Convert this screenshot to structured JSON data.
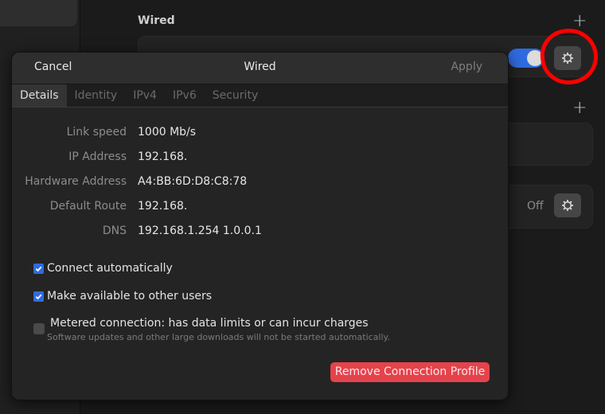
{
  "background": {
    "section_title": "Wired",
    "off_label": "Off"
  },
  "dialog": {
    "header": {
      "cancel_label": "Cancel",
      "title": "Wired",
      "apply_label": "Apply"
    },
    "tabs": [
      {
        "label": "Details",
        "active": true
      },
      {
        "label": "Identity",
        "active": false
      },
      {
        "label": "IPv4",
        "active": false
      },
      {
        "label": "IPv6",
        "active": false
      },
      {
        "label": "Security",
        "active": false
      }
    ],
    "details": [
      {
        "label": "Link speed",
        "value": "1000 Mb/s"
      },
      {
        "label": "IP Address",
        "value": "192.168."
      },
      {
        "label": "Hardware Address",
        "value": "A4:BB:6D:D8:C8:78"
      },
      {
        "label": "Default Route",
        "value": "192.168."
      },
      {
        "label": "DNS",
        "value": "192.168.1.254 1.0.0.1"
      }
    ],
    "options": {
      "connect_automatically": {
        "label": "Connect automatically",
        "checked": true
      },
      "available_to_others": {
        "label": "Make available to other users",
        "checked": true
      },
      "metered": {
        "label": "Metered connection: has data limits or can incur charges",
        "sublabel": "Software updates and other large downloads will not be started automatically.",
        "checked": false
      }
    },
    "remove_label": "Remove Connection Profile"
  },
  "colors": {
    "accent": "#2f6be0",
    "destructive": "#e5434c",
    "annotation": "#ff0000"
  }
}
